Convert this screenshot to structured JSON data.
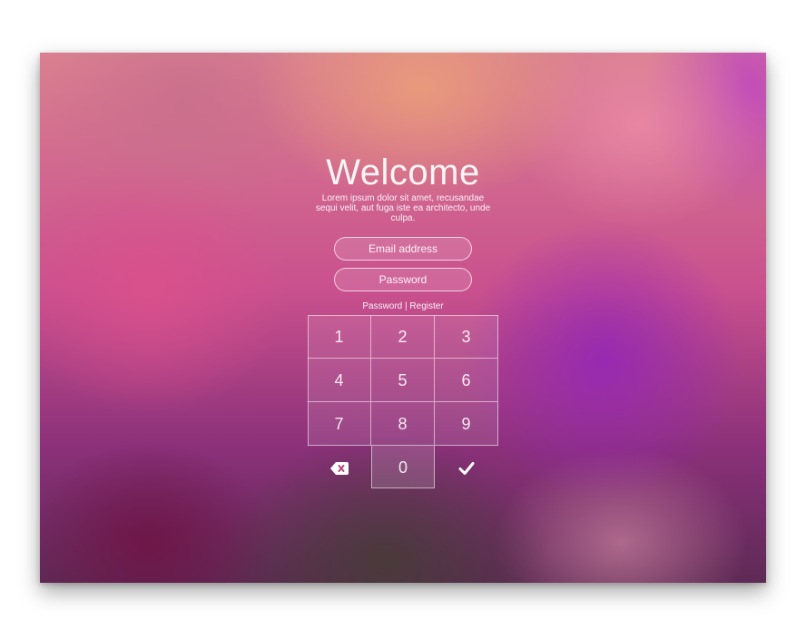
{
  "welcome": {
    "title": "Welcome",
    "subtitle": "Lorem ipsum dolor sit amet, recusandae sequi velit, aut fuga iste ea architecto, unde culpa."
  },
  "form": {
    "email_placeholder": "Email address",
    "password_placeholder": "Password"
  },
  "links": {
    "password": "Password",
    "separator": "|",
    "register": "Register"
  },
  "keypad": {
    "keys": [
      "1",
      "2",
      "3",
      "4",
      "5",
      "6",
      "7",
      "8",
      "9"
    ],
    "zero": "0",
    "delete_icon": "backspace-icon",
    "submit_icon": "checkmark-icon"
  }
}
